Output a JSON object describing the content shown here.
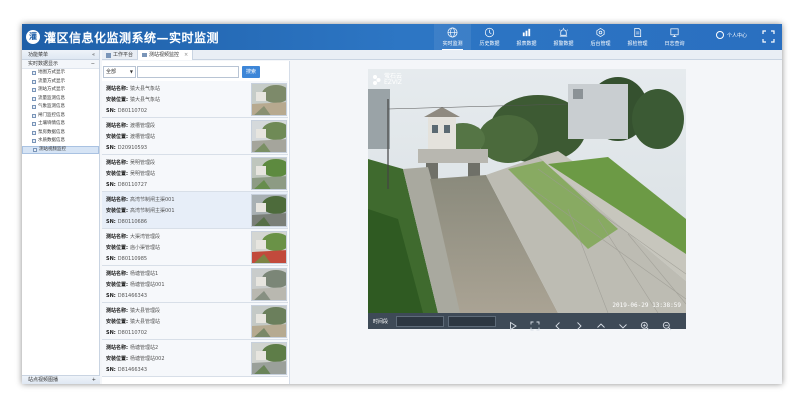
{
  "app": {
    "logo_text": "灌",
    "title": "灌区信息化监测系统—实时监测"
  },
  "nav": [
    {
      "icon": "globe-icon",
      "label": "实时监测",
      "active": true
    },
    {
      "icon": "history-icon",
      "label": "历史数据",
      "active": false
    },
    {
      "icon": "report-icon",
      "label": "报表数据",
      "active": false
    },
    {
      "icon": "warning-icon",
      "label": "报警数据",
      "active": false
    },
    {
      "icon": "settings-icon",
      "label": "后台管理",
      "active": false
    },
    {
      "icon": "document-icon",
      "label": "报检管理",
      "active": false
    },
    {
      "icon": "log-icon",
      "label": "日志查询",
      "active": false
    }
  ],
  "user": {
    "label": "个人中心"
  },
  "sidebar": {
    "menu_title": "功能菜单",
    "menu_toggle": "«",
    "group_label": "实时数据显示",
    "group_toggle": "−",
    "items": [
      {
        "label": "地图方式显示",
        "selected": false
      },
      {
        "label": "流量方式显示",
        "selected": false
      },
      {
        "label": "测站方式显示",
        "selected": false
      },
      {
        "label": "流量监测信息",
        "selected": false
      },
      {
        "label": "气象监测信息",
        "selected": false
      },
      {
        "label": "闸门监控信息",
        "selected": false
      },
      {
        "label": "土壤墒情信息",
        "selected": false
      },
      {
        "label": "泵房数据信息",
        "selected": false
      },
      {
        "label": "水质数据信息",
        "selected": false
      },
      {
        "label": "测站视频监控",
        "selected": true
      }
    ],
    "bottom_label": "站点视频图播",
    "bottom_toggle": "+"
  },
  "tabs": [
    {
      "label": "工作平台",
      "active": false,
      "closable": false
    },
    {
      "label": "测站视频监控",
      "active": true,
      "closable": true
    }
  ],
  "filter": {
    "selected": "全部",
    "search_placeholder": "",
    "search_button": "搜索"
  },
  "field_labels": {
    "name": "测站名称:",
    "location": "安装位置:",
    "sn": "SN:"
  },
  "stations": [
    {
      "name": "猿大县气象站",
      "location": "猿大县气象站",
      "sn": "D80110702",
      "selected": false
    },
    {
      "name": "渡槽管理段",
      "location": "渡槽管理站",
      "sn": "D20910593",
      "selected": false
    },
    {
      "name": "吴明管理段",
      "location": "吴明管理站",
      "sn": "D80110727",
      "selected": false
    },
    {
      "name": "高湾节制闸主渠001",
      "location": "高湾节制闸主渠001",
      "sn": "D80110686",
      "selected": true
    },
    {
      "name": "大渠湾管理段",
      "location": "庙小渠管理站",
      "sn": "D80110985",
      "selected": false
    },
    {
      "name": "杨塘管理站1",
      "location": "杨塘管理站001",
      "sn": "D81466343",
      "selected": false
    },
    {
      "name": "猿大县管理段",
      "location": "猿大县管理站",
      "sn": "D80110702",
      "selected": false
    },
    {
      "name": "杨塘管理站2",
      "location": "杨塘管理站002",
      "sn": "D81466343",
      "selected": false
    }
  ],
  "video": {
    "watermark_line1": "萤石云",
    "watermark_line2": "EZVIZ",
    "timestamp": "2019-06-29 13:38:59"
  },
  "controls": {
    "time_label": "时间段"
  }
}
